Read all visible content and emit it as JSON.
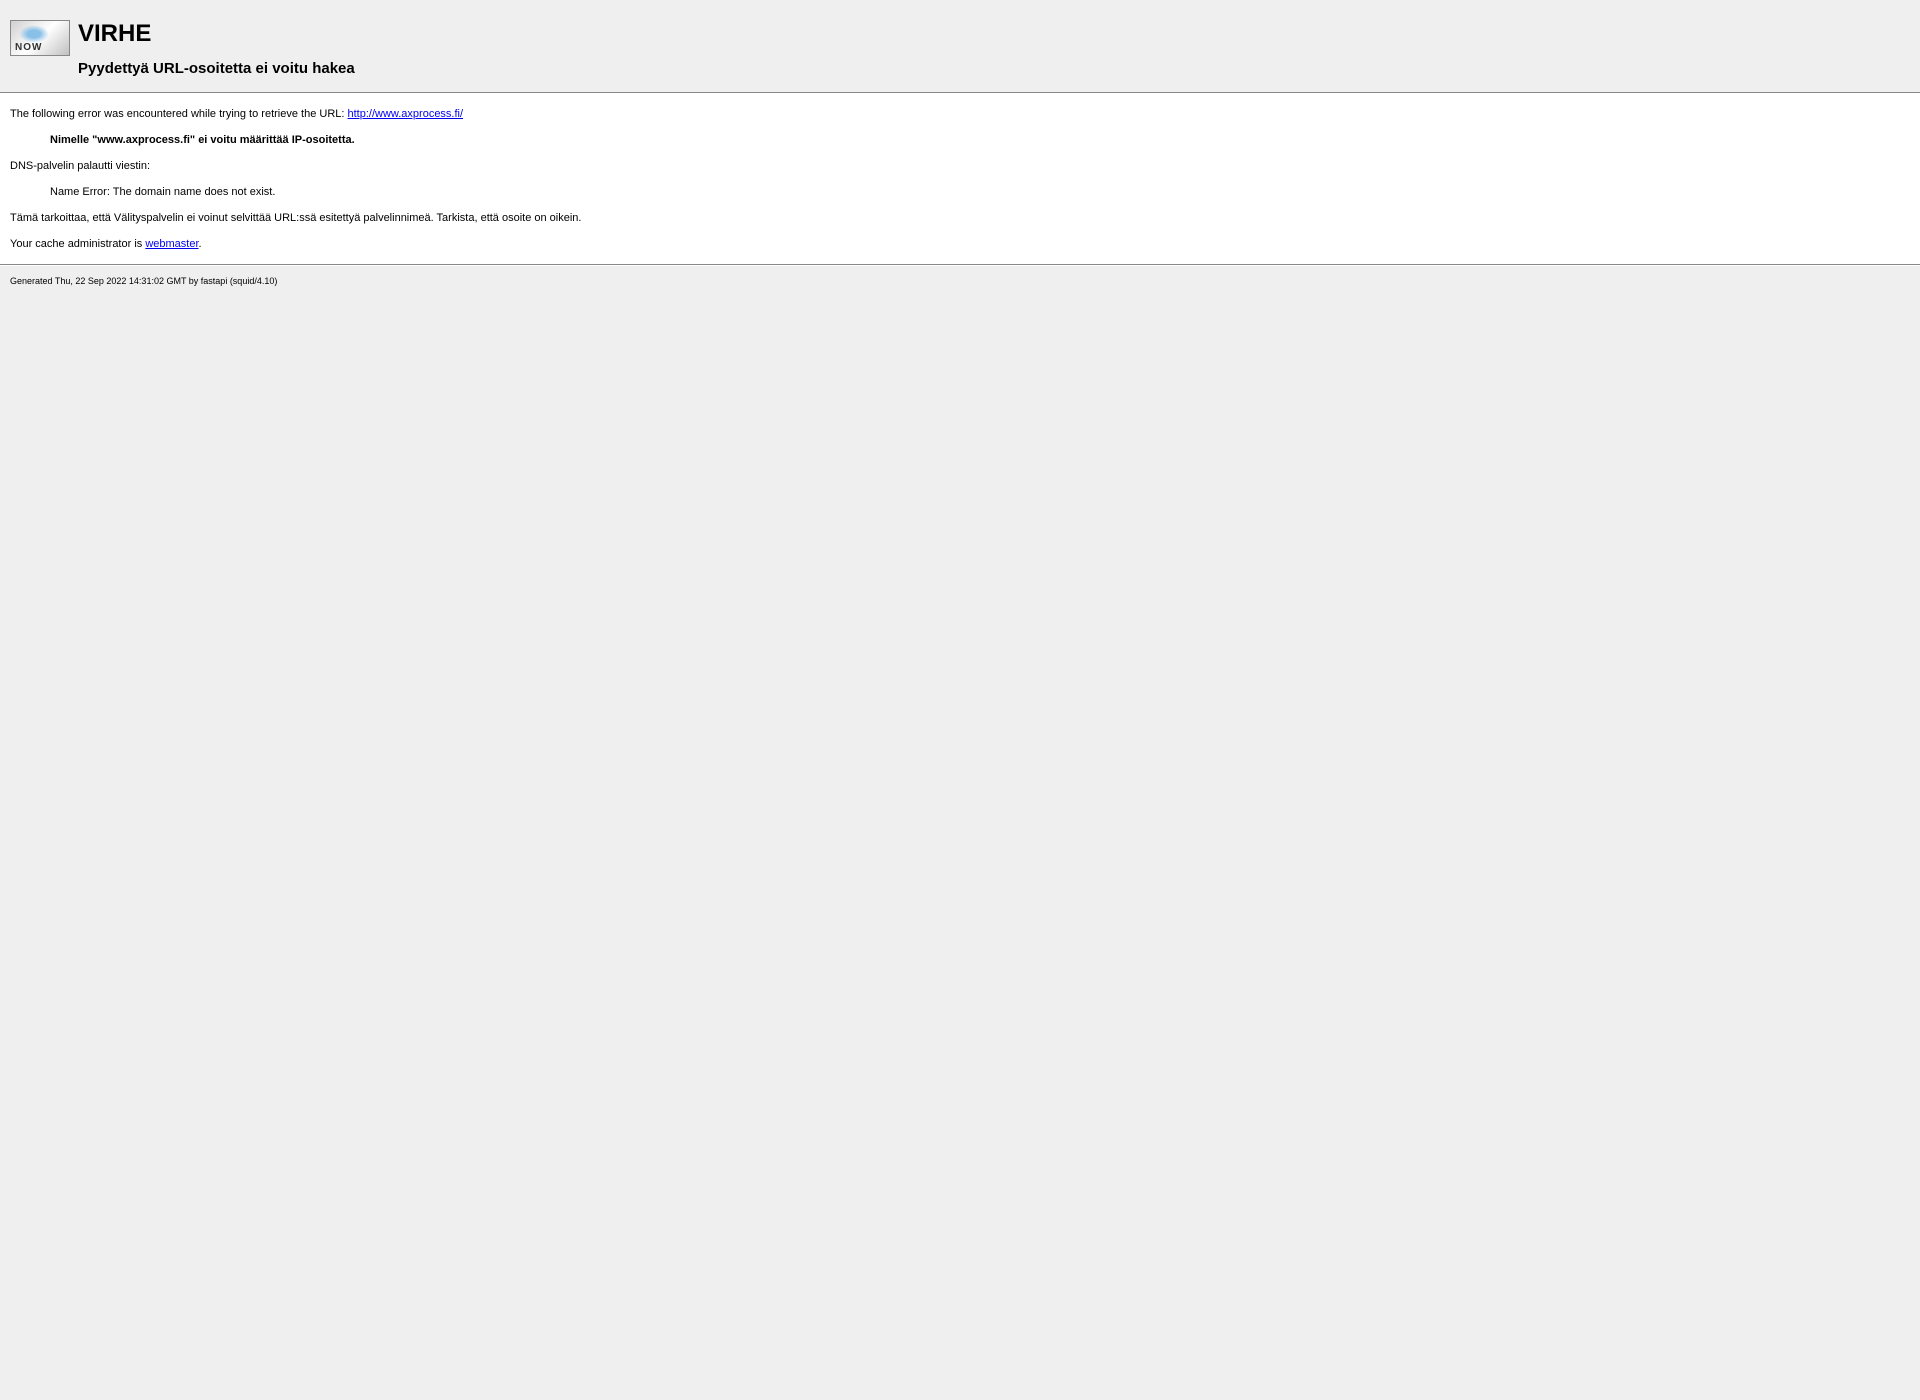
{
  "header": {
    "title": "VIRHE",
    "subtitle": "Pyydettyä URL-osoitetta ei voitu hakea"
  },
  "content": {
    "intro_text": "The following error was encountered while trying to retrieve the URL: ",
    "url_link": "http://www.axprocess.fi/",
    "error_detail": "Nimelle \"www.axprocess.fi\" ei voitu määrittää IP-osoitetta.",
    "dns_message": "DNS-palvelin palautti viestin:",
    "dns_error": "Name Error: The domain name does not exist.",
    "explanation": "Tämä tarkoittaa, että Välityspalvelin ei voinut selvittää URL:ssä esitettyä palvelinnimeä. Tarkista, että osoite on oikein.",
    "admin_text": "Your cache administrator is ",
    "admin_link": "webmaster",
    "admin_period": "."
  },
  "footer": {
    "generated": "Generated Thu, 22 Sep 2022 14:31:02 GMT by fastapi (squid/4.10)"
  }
}
